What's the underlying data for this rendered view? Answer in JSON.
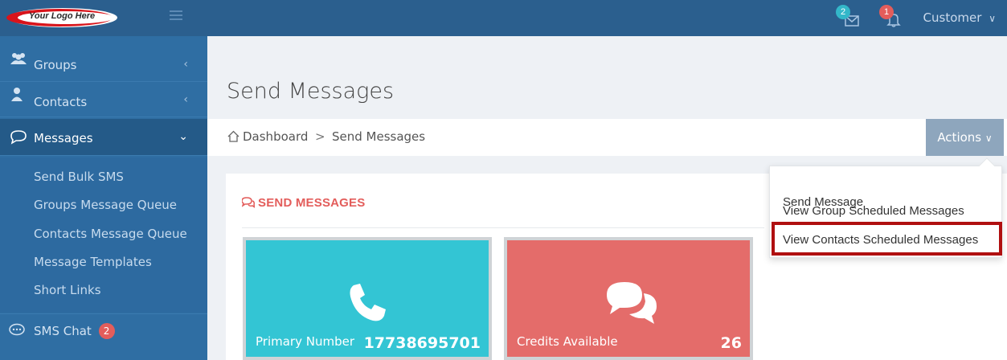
{
  "header": {
    "logo_text": "Your Logo Here",
    "messages_badge": "2",
    "notifications_badge": "1",
    "user_label": "Customer"
  },
  "sidebar": {
    "items": [
      {
        "label": "Groups",
        "icon": "users-icon"
      },
      {
        "label": "Contacts",
        "icon": "user-icon"
      },
      {
        "label": "Messages",
        "icon": "chat-bubble-icon"
      }
    ],
    "messages_sub": [
      {
        "label": "Send Bulk SMS"
      },
      {
        "label": "Groups Message Queue"
      },
      {
        "label": "Contacts Message Queue"
      },
      {
        "label": "Message Templates"
      },
      {
        "label": "Short Links"
      }
    ],
    "sms_chat": {
      "label": "SMS Chat",
      "badge": "2",
      "icon": "chat-dots-icon"
    }
  },
  "page": {
    "title": "Send Messages",
    "breadcrumb": {
      "home": "Dashboard",
      "current": "Send Messages",
      "separator": ">"
    },
    "actions_label": "Actions",
    "panel_title": "SEND MESSAGES"
  },
  "actions_menu": {
    "items": [
      {
        "label": "Send Message"
      },
      {
        "label": "View Group Scheduled Messages"
      },
      {
        "label": "View Contacts Scheduled Messages",
        "highlighted": true
      }
    ]
  },
  "cards": [
    {
      "label": "Primary Number",
      "value": "17738695701",
      "icon": "phone-icon",
      "color": "#33c5d4"
    },
    {
      "label": "Credits Available",
      "value": "26",
      "icon": "chat-bubbles-icon",
      "color": "#e46c6a"
    }
  ],
  "colors": {
    "topbar": "#2b5f8e",
    "sidebar": "#2f6ea3",
    "accent": "#e35d5b",
    "highlight_border": "#b00f10"
  }
}
